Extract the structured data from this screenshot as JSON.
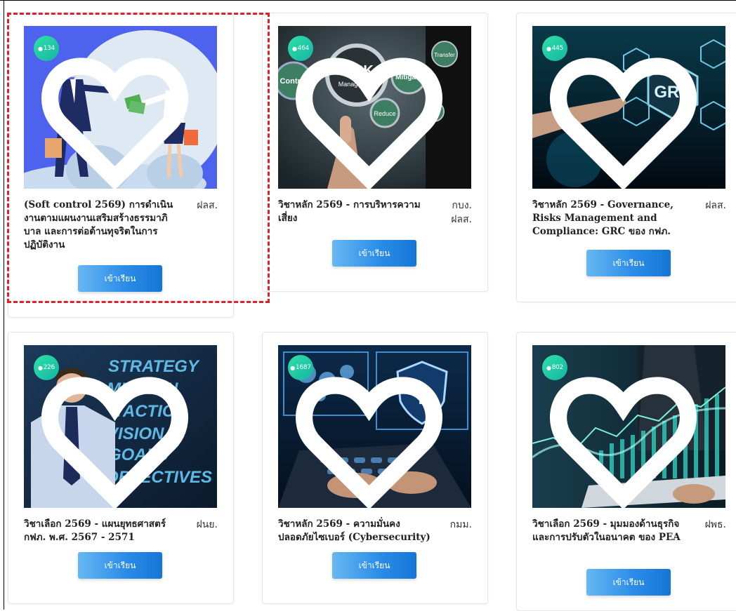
{
  "courses": [
    {
      "views": "134",
      "title": "(Soft control 2569) การดำเนินงานตามแผนงานเสริมสร้างธรรมาภิบาล และการต่อต้านทุจริตในการปฏิบัติงาน",
      "dept": "ฝลส.",
      "button_label": "เข้าเรียน",
      "image": "anti-corruption-illustration"
    },
    {
      "views": "464",
      "title": "วิชาหลัก 2569 - การบริหารความเสี่ยง",
      "dept": "กบง. ฝลส.",
      "button_label": "เข้าเรียน",
      "image": "risk-management-gears",
      "image_text": [
        "Control",
        "RISK",
        "Management",
        "Mitigate",
        "Transfer",
        "Reduce",
        "Avoid"
      ]
    },
    {
      "views": "445",
      "title": "วิชาหลัก 2569 - Governance, Risks Management and Compliance: GRC ของ กฟภ.",
      "dept": "ฝลส.",
      "button_label": "เข้าเรียน",
      "image": "grc-hexagons",
      "image_text": [
        "GRC"
      ]
    },
    {
      "views": "226",
      "title": "วิชาเลือก 2569 - แผนยุทธศาสตร์ กฟภ. พ.ศ. 2567 - 2571",
      "dept": "ฝนย.",
      "button_label": "เข้าเรียน",
      "image": "strategy-businessman",
      "image_text": [
        "STRATEGY",
        "MISSION",
        "TACTICS",
        "VISION",
        "GOALS",
        "OBJECTIVES"
      ]
    },
    {
      "views": "1687",
      "title": "วิชาหลัก 2569 - ความมั่นคงปลอดภัยไซเบอร์ (Cybersecurity)",
      "dept": "กมม.",
      "button_label": "เข้าเรียน",
      "image": "cybersecurity-laptop"
    },
    {
      "views": "802",
      "title": "วิชาเลือก 2569 - มุมมองด้านธุรกิจและการปรับตัวในอนาคต ของ PEA",
      "dept": "ฝพธ.",
      "button_label": "เข้าเรียน",
      "image": "business-chart-tablet"
    }
  ],
  "colors": {
    "accent_button": "#2c8de8",
    "view_badge": "#15b6a2",
    "highlight": "#e0202a"
  }
}
